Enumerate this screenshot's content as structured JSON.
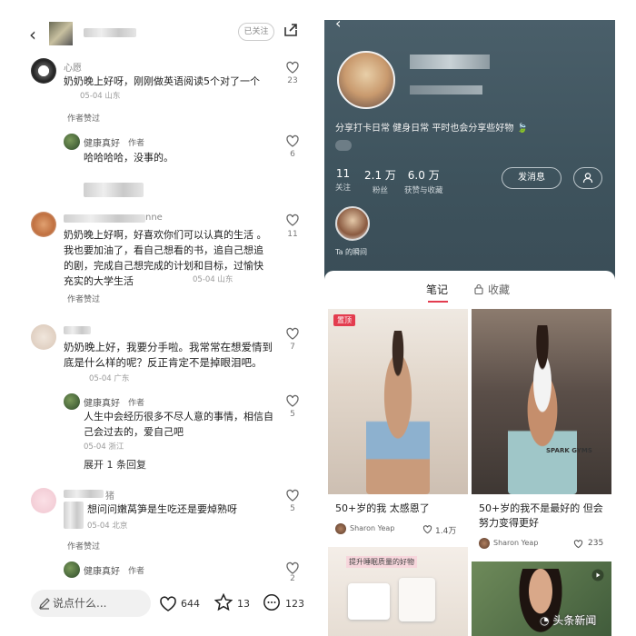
{
  "left": {
    "header": {
      "followed_label": "已关注"
    },
    "comments": [
      {
        "name": "心愿",
        "text": "奶奶晚上好呀，刚刚做英语阅读5个对了一个",
        "date": "05-04 山东",
        "likes": "23",
        "tag": "作者赞过"
      },
      {
        "reply": true,
        "name": "健康真好",
        "role": "作者",
        "text": "哈哈哈哈，没事的。",
        "likes": "6"
      },
      {
        "name": "",
        "name_suffix": "nne",
        "text": "奶奶晚上好啊，好喜欢你们可以认真的生活 。我也要加油了，看自己想看的书，追自己想追的剧，完成自己想完成的计划和目标，过愉快充实的大学生活",
        "date": "05-04 山东",
        "likes": "11",
        "tag": "作者赞过"
      },
      {
        "name": "",
        "text": "奶奶晚上好，我要分手啦。我常常在想爱情到底是什么样的呢？反正肯定不是掉眼泪吧。",
        "date": "05-04 广东",
        "likes": "7"
      },
      {
        "reply": true,
        "name": "健康真好",
        "role": "作者",
        "text": "人生中会经历很多不尽人意的事情，相信自己会过去的，爱自己吧",
        "date": "05-04 浙江",
        "likes": "5"
      },
      {
        "expand": "展开 1 条回复"
      },
      {
        "name": "",
        "name_suffix": "猪",
        "text": "想问问嫩莴笋是生吃还是要焯熟呀",
        "date": "05-04 北京",
        "likes": "5",
        "tag": "作者赞过"
      },
      {
        "reply": true,
        "name": "健康真好",
        "role": "作者",
        "likes": "2"
      }
    ],
    "bottom": {
      "input_placeholder": "说点什么...",
      "likes": "644",
      "stars": "13",
      "comments": "123"
    }
  },
  "right": {
    "bio": "分享打卡日常 健身日常 平时也会分享些好物",
    "stats": [
      {
        "n": "11",
        "l": "关注"
      },
      {
        "n": "2.1 万",
        "l": "粉丝"
      },
      {
        "n": "6.0 万",
        "l": "获赞与收藏"
      }
    ],
    "message_btn": "发消息",
    "story_label": "Ta 的瞬间",
    "tabs": {
      "notes": "笔记",
      "collect": "收藏"
    },
    "cards": [
      {
        "pin": "置顶",
        "title": "50+岁的我 太感恩了",
        "user": "Sharon Yeap",
        "likes": "1.4万"
      },
      {
        "title": "50+岁的我不是最好的 但会努力变得更好",
        "user": "Sharon Yeap",
        "likes": "235",
        "img_text": "SPARK GYMS"
      },
      {
        "img_text": "提升睡眠质量的好物"
      }
    ]
  },
  "watermark": "头条新闻",
  "colors": {
    "accent": "#e33c4f",
    "profile_bg": "#4a5f6a"
  }
}
